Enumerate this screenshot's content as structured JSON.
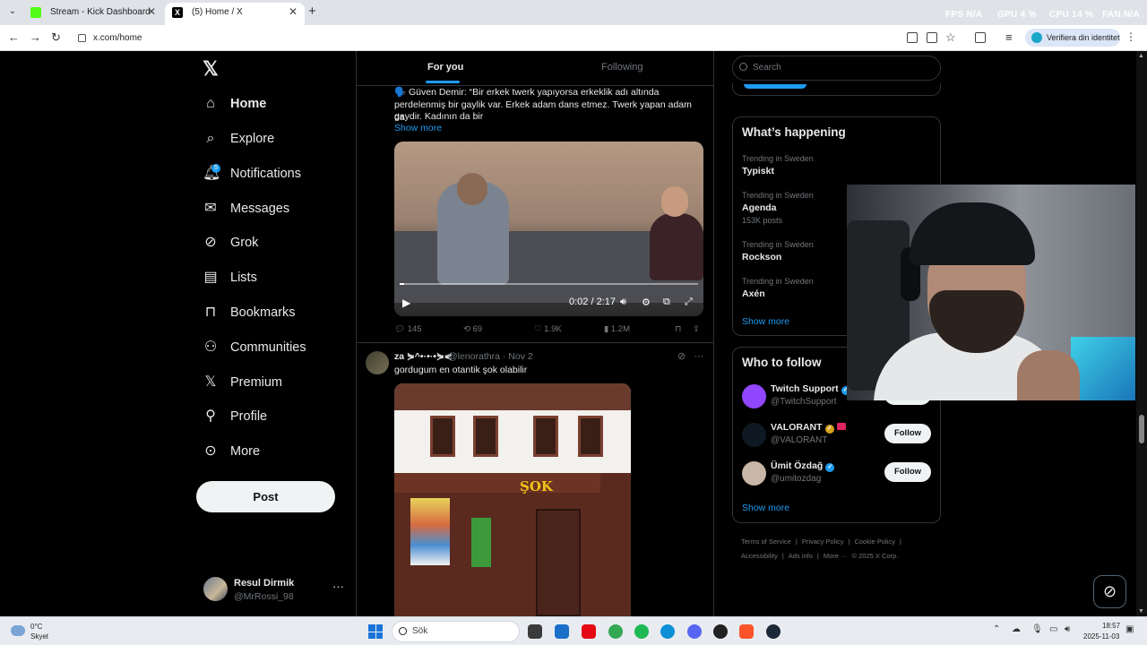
{
  "browser": {
    "tabs": [
      {
        "title": "Stream - Kick Dashboard",
        "favicon": "kick-icon"
      },
      {
        "title": "(5) Home / X",
        "favicon": "x-logo-icon"
      }
    ],
    "new_tab": "+",
    "perf": {
      "fps": "FPS N/A",
      "gpu": "GPU 4 %",
      "cpu": "CPU 14 %",
      "fan": "FAN N/A"
    },
    "url": "x.com/home",
    "verify_chip": "Verifiera din identitet"
  },
  "sidebar": {
    "logo": "𝕏",
    "items": [
      {
        "label": "Home",
        "icon": "home-icon"
      },
      {
        "label": "Explore",
        "icon": "search-icon"
      },
      {
        "label": "Notifications",
        "icon": "bell-icon"
      },
      {
        "label": "Messages",
        "icon": "envelope-icon"
      },
      {
        "label": "Grok",
        "icon": "grok-icon"
      },
      {
        "label": "Lists",
        "icon": "list-icon"
      },
      {
        "label": "Bookmarks",
        "icon": "bookmark-icon"
      },
      {
        "label": "Communities",
        "icon": "people-icon"
      },
      {
        "label": "Premium",
        "icon": "x-logo-icon"
      },
      {
        "label": "Profile",
        "icon": "person-icon"
      },
      {
        "label": "More",
        "icon": "more-circle-icon"
      }
    ],
    "notifications_badge": "5",
    "post_button": "Post",
    "user": {
      "name": "Resul Dirmik",
      "handle": "@MrRossi_98",
      "more": "···"
    }
  },
  "feed": {
    "tabs": [
      "For you",
      "Following"
    ],
    "tweet1": {
      "text_line1": "🗣️ Güven Demir: “Bir erkek twerk yapıyorsa erkeklik adı altında",
      "text_line2": "perdelenmiş bir gaylik var. Erkek adam dans etmez. Twerk yapan adam da",
      "text_line3": "gaydir. Kadının da bir",
      "show_more": "Show more",
      "video": {
        "time": "0:02 / 2:17",
        "progress": 0.015
      },
      "replies": "145",
      "reposts": "69",
      "likes": "1.9K",
      "views": "1.2M"
    },
    "tweet2": {
      "name": "za ⋟^•·•·•⋟⋞",
      "handle": "@lenorathra",
      "date": "Nov 2",
      "text": "gordugum en otantik şok olabilir",
      "photo_sign": "ŞOK"
    }
  },
  "right": {
    "search_placeholder": "Search",
    "whats_happening": {
      "title": "What’s happening",
      "trends": [
        {
          "category": "Trending in Sweden",
          "name": "Typiskt",
          "posts": ""
        },
        {
          "category": "Trending in Sweden",
          "name": "Agenda",
          "posts": "153K posts"
        },
        {
          "category": "Trending in Sweden",
          "name": "Rockson",
          "posts": ""
        },
        {
          "category": "Trending in Sweden",
          "name": "Axén",
          "posts": ""
        }
      ],
      "show_more": "Show more"
    },
    "who_to_follow": {
      "title": "Who to follow",
      "accounts": [
        {
          "name": "Twitch Support",
          "handle": "@TwitchSupport",
          "follow": "Follow",
          "avatar_color": "#9146ff"
        },
        {
          "name": "VALORANT",
          "handle": "@VALORANT",
          "follow": "Follow",
          "avatar_color": "#0f1923"
        },
        {
          "name": "Ümit Özdağ",
          "handle": "@umitozdag",
          "follow": "Follow",
          "avatar_color": "#c8b6a6"
        }
      ],
      "show_more": "Show more"
    },
    "footer": [
      "Terms of Service",
      "|",
      "Privacy Policy",
      "|",
      "Cookie Policy",
      "|",
      "Accessibility",
      "|",
      "Ads info",
      "|",
      "More ···",
      "© 2025 X Corp."
    ]
  },
  "taskbar": {
    "weather_temp": "0°C",
    "weather_desc": "Skyet",
    "search_placeholder": "Sök",
    "time": "18:57",
    "date": "2025-11-03"
  }
}
